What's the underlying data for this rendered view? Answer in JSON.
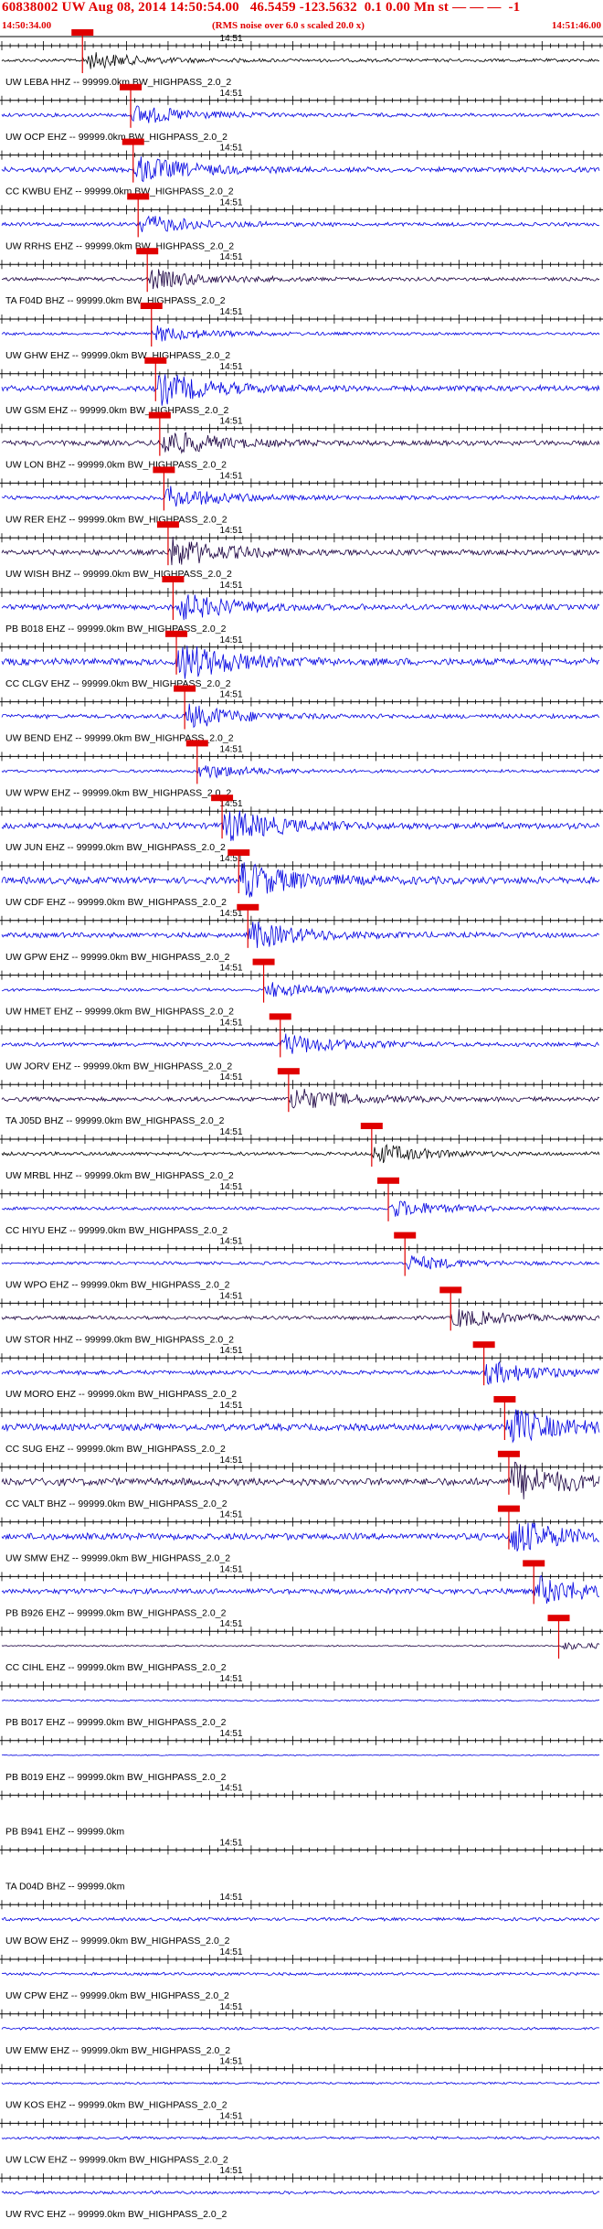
{
  "header": {
    "title": "60838002 UW Aug 08, 2014 14:50:54.00   46.5459 -123.5632  0.1 0.00 Mn st — — —  -1",
    "start_time": "14:50:34.00",
    "rms_note": "(RMS noise over 6.0 s scaled 20.0 x)",
    "end_time": "14:51:46.00"
  },
  "colors": {
    "header_text": "#e00000",
    "pick": "#e00000",
    "axis": "#000000",
    "trace_blue": "#0000e0",
    "trace_dark": "#1a0040"
  },
  "chart_data": {
    "type": "line",
    "title": "60838002 UW Aug 08, 2014 14:50:54.00   46.5459 -123.5632  0.1 0.00 Mn st — — —  -1",
    "x_start": "14:50:34.00",
    "x_end": "14:51:46.00",
    "time_axis_label": "14:51",
    "x_range_seconds": [
      0,
      72
    ],
    "y_unit": "counts (normalized)",
    "grid": false,
    "legend": "none",
    "traces": [
      {
        "label": "UW LEBA HHZ -- 99999.0km BW_HIGHPASS_2.0_2",
        "color": "#000000",
        "pick_s": 9.7,
        "amp": 0.45
      },
      {
        "label": "UW OCP EHZ -- 99999.0km BW_HIGHPASS_2.0_2",
        "color": "#0000e0",
        "pick_s": 15.5,
        "amp": 0.5
      },
      {
        "label": "CC KWBU EHZ -- 99999.0km BW_HIGHPASS_2.0_2",
        "color": "#0000e0",
        "pick_s": 15.8,
        "amp": 0.7
      },
      {
        "label": "UW RRHS EHZ -- 99999.0km BW_HIGHPASS_2.0_2",
        "color": "#0000e0",
        "pick_s": 16.4,
        "amp": 0.5
      },
      {
        "label": "TA F04D BHZ -- 99999.0km BW_HIGHPASS_2.0_2",
        "color": "#1a0040",
        "pick_s": 17.5,
        "amp": 0.5
      },
      {
        "label": "UW GHW EHZ -- 99999.0km BW_HIGHPASS_2.0_2",
        "color": "#0000e0",
        "pick_s": 18.0,
        "amp": 0.4
      },
      {
        "label": "UW GSM EHZ -- 99999.0km BW_HIGHPASS_2.0_2",
        "color": "#0000e0",
        "pick_s": 18.5,
        "amp": 0.8
      },
      {
        "label": "UW LON BHZ -- 99999.0km BW_HIGHPASS_2.0_2",
        "color": "#1a0040",
        "pick_s": 19.0,
        "amp": 0.7
      },
      {
        "label": "UW RER EHZ -- 99999.0km BW_HIGHPASS_2.0_2",
        "color": "#0000e0",
        "pick_s": 19.5,
        "amp": 0.55
      },
      {
        "label": "UW WISH BHZ -- 99999.0km BW_HIGHPASS_2.0_2",
        "color": "#1a0040",
        "pick_s": 20.0,
        "amp": 0.75
      },
      {
        "label": "PB B018 EHZ -- 99999.0km BW_HIGHPASS_2.0_2",
        "color": "#0000e0",
        "pick_s": 20.6,
        "amp": 0.75
      },
      {
        "label": "CC CLGV EHZ -- 99999.0km BW_HIGHPASS_2.0_2",
        "color": "#0000e0",
        "pick_s": 21.0,
        "amp": 0.95
      },
      {
        "label": "UW BEND EHZ -- 99999.0km BW_HIGHPASS_2.0_2",
        "color": "#0000e0",
        "pick_s": 22.0,
        "amp": 0.6
      },
      {
        "label": "UW WPW EHZ -- 99999.0km BW_HIGHPASS_2.0_2",
        "color": "#0000e0",
        "pick_s": 23.5,
        "amp": 0.4
      },
      {
        "label": "UW JUN EHZ -- 99999.0km BW_HIGHPASS_2.0_2",
        "color": "#0000e0",
        "pick_s": 26.5,
        "amp": 0.85
      },
      {
        "label": "UW CDF EHZ -- 99999.0km BW_HIGHPASS_2.0_2",
        "color": "#0000e0",
        "pick_s": 28.5,
        "amp": 0.95
      },
      {
        "label": "UW GPW EHZ -- 99999.0km BW_HIGHPASS_2.0_2",
        "color": "#0000e0",
        "pick_s": 29.6,
        "amp": 0.7
      },
      {
        "label": "UW HMET EHZ -- 99999.0km BW_HIGHPASS_2.0_2",
        "color": "#0000e0",
        "pick_s": 31.5,
        "amp": 0.4
      },
      {
        "label": "UW JORV EHZ -- 99999.0km BW_HIGHPASS_2.0_2",
        "color": "#0000e0",
        "pick_s": 33.5,
        "amp": 0.55
      },
      {
        "label": "TA J05D BHZ -- 99999.0km BW_HIGHPASS_2.0_2",
        "color": "#1a0040",
        "pick_s": 34.5,
        "amp": 0.6
      },
      {
        "label": "UW MRBL HHZ -- 99999.0km BW_HIGHPASS_2.0_2",
        "color": "#000000",
        "pick_s": 44.5,
        "amp": 0.5
      },
      {
        "label": "CC HIYU EHZ -- 99999.0km BW_HIGHPASS_2.0_2",
        "color": "#0000e0",
        "pick_s": 46.5,
        "amp": 0.45
      },
      {
        "label": "UW WPO EHZ -- 99999.0km BW_HIGHPASS_2.0_2",
        "color": "#0000e0",
        "pick_s": 48.5,
        "amp": 0.4
      },
      {
        "label": "UW STOR HHZ -- 99999.0km BW_HIGHPASS_2.0_2",
        "color": "#1a0040",
        "pick_s": 54.0,
        "amp": 0.5
      },
      {
        "label": "UW MORO EHZ -- 99999.0km BW_HIGHPASS_2.0_2",
        "color": "#0000e0",
        "pick_s": 58.0,
        "amp": 0.6
      },
      {
        "label": "CC SUG EHZ -- 99999.0km BW_HIGHPASS_2.0_2",
        "color": "#0000e0",
        "pick_s": 60.5,
        "amp": 0.95
      },
      {
        "label": "CC VALT BHZ -- 99999.0km BW_HIGHPASS_2.0_2",
        "color": "#1a0040",
        "pick_s": 61.0,
        "amp": 1.0
      },
      {
        "label": "UW SMW EHZ -- 99999.0km BW_HIGHPASS_2.0_2",
        "color": "#0000e0",
        "pick_s": 61.0,
        "amp": 0.9
      },
      {
        "label": "PB B926 EHZ -- 99999.0km BW_HIGHPASS_2.0_2",
        "color": "#0000e0",
        "pick_s": 64.0,
        "amp": 0.75
      },
      {
        "label": "CC CIHL EHZ -- 99999.0km BW_HIGHPASS_2.0_2",
        "color": "#1a0040",
        "pick_s": 67.0,
        "amp": 0.2
      },
      {
        "label": "PB B017 EHZ -- 99999.0km BW_HIGHPASS_2.0_2",
        "color": "#0000e0",
        "amp": 0.2
      },
      {
        "label": "PB B019 EHZ -- 99999.0km BW_HIGHPASS_2.0_2",
        "color": "#0000e0",
        "amp": 0.15
      },
      {
        "label": "PB B941 EHZ -- 99999.0km",
        "color": "#0000e0",
        "amp": 0.0
      },
      {
        "label": "TA D04D BHZ -- 99999.0km",
        "color": "#0000e0",
        "amp": 0.0
      },
      {
        "label": "UW BOW EHZ -- 99999.0km BW_HIGHPASS_2.0_2",
        "color": "#0000e0",
        "amp": 0.45
      },
      {
        "label": "UW CPW EHZ -- 99999.0km BW_HIGHPASS_2.0_2",
        "color": "#0000e0",
        "amp": 0.4
      },
      {
        "label": "UW EMW EHZ -- 99999.0km BW_HIGHPASS_2.0_2",
        "color": "#0000e0",
        "amp": 0.35
      },
      {
        "label": "UW KOS EHZ -- 99999.0km BW_HIGHPASS_2.0_2",
        "color": "#0000e0",
        "amp": 0.3
      },
      {
        "label": "UW LCW EHZ -- 99999.0km BW_HIGHPASS_2.0_2",
        "color": "#0000e0",
        "amp": 0.35
      },
      {
        "label": "UW RVC EHZ -- 99999.0km BW_HIGHPASS_2.0_2",
        "color": "#0000e0",
        "amp": 0.4
      }
    ]
  }
}
